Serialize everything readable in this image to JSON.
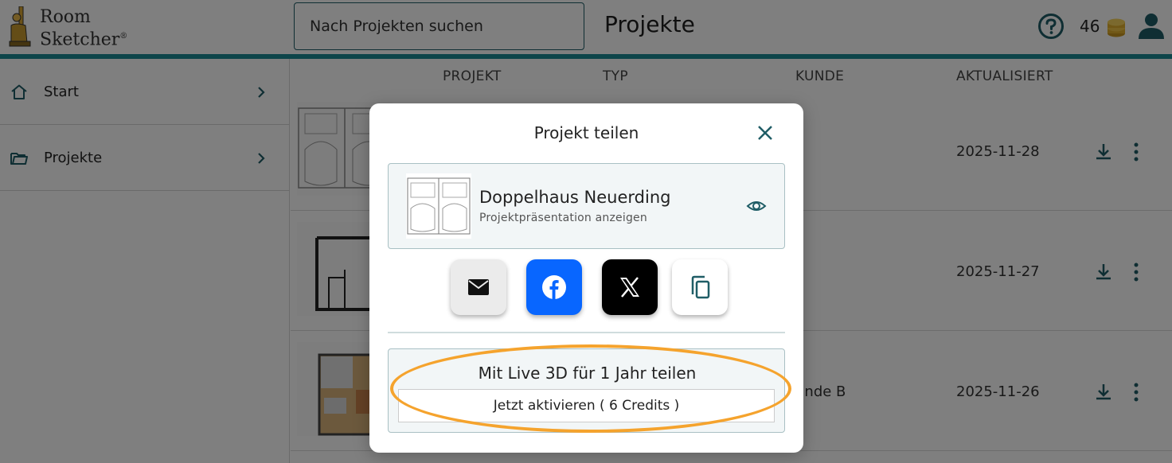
{
  "header": {
    "logo_line1": "Room",
    "logo_line2": "Sketcher",
    "logo_reg": "®",
    "search_placeholder": "Nach Projekten suchen",
    "page_title": "Projekte",
    "credits": "46"
  },
  "sidebar": {
    "items": [
      {
        "label": "Start",
        "icon": "home-icon"
      },
      {
        "label": "Projekte",
        "icon": "folder-icon"
      }
    ]
  },
  "table": {
    "columns": [
      "PROJEKT",
      "TYP",
      "KUNDE",
      "AKTUALISIERT"
    ],
    "rows": [
      {
        "kunde": "",
        "updated": "2025-11-28"
      },
      {
        "kunde": "",
        "updated": "2025-11-27"
      },
      {
        "kunde": "unde B",
        "updated": "2025-11-26"
      }
    ]
  },
  "modal": {
    "title": "Projekt teilen",
    "project_name": "Doppelhaus Neuerding",
    "project_sub": "Projektpräsentation anzeigen",
    "share_buttons": [
      "mail-icon",
      "facebook-icon",
      "x-icon",
      "copy-icon"
    ],
    "live_title": "Mit Live 3D für 1 Jahr teilen",
    "activate_label": "Jetzt aktivieren ( 6 Credits )"
  },
  "colors": {
    "accent": "#1a8a94",
    "icon": "#1f5d66",
    "facebook": "#0866ff",
    "highlight": "#f5a32d"
  }
}
